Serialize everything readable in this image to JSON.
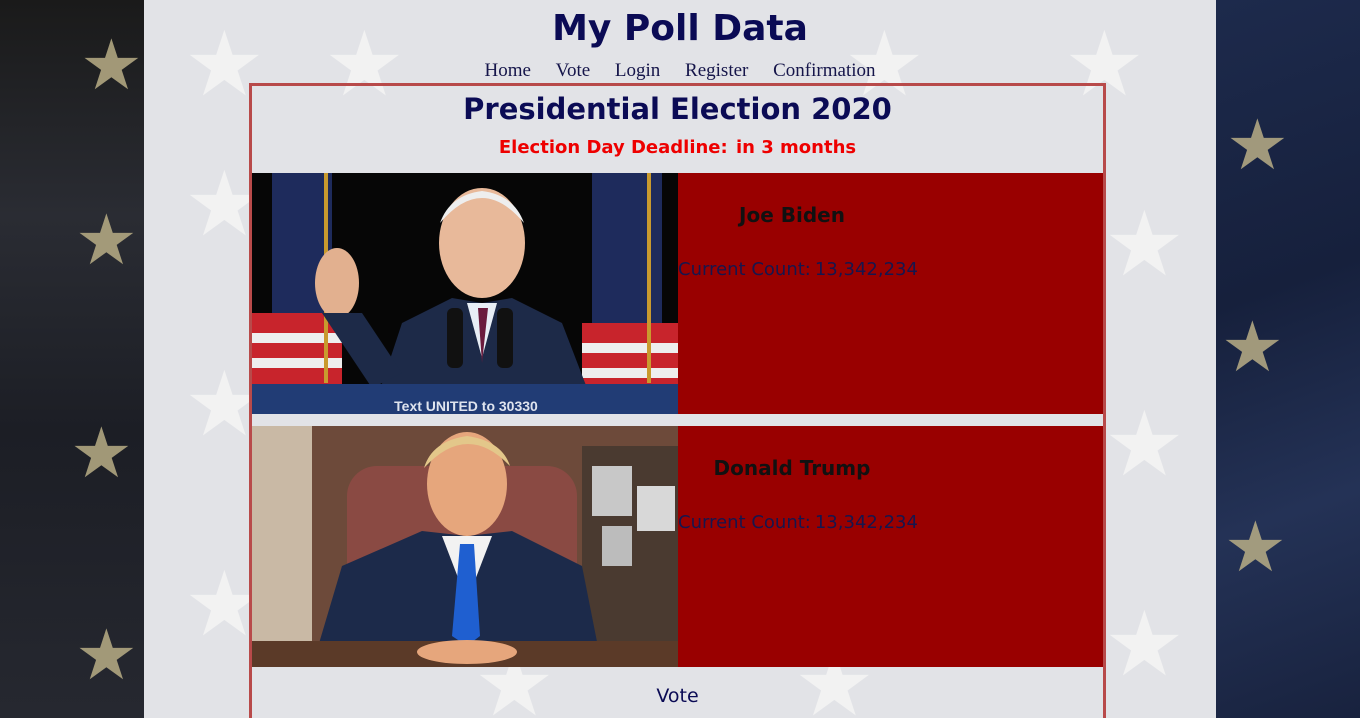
{
  "site": {
    "title": "My Poll Data"
  },
  "nav": [
    {
      "label": "Home"
    },
    {
      "label": "Vote"
    },
    {
      "label": "Login"
    },
    {
      "label": "Register"
    },
    {
      "label": "Confirmation"
    }
  ],
  "poll": {
    "title": "Presidential Election 2020",
    "deadline_label": "Election Day Deadline:",
    "deadline_value": "in 3 months",
    "vote_label": "Vote",
    "candidates": [
      {
        "name": "Joe Biden",
        "count_label": "Current Count:",
        "count": "13,342,234",
        "podium_text": "Text UNITED to 30330"
      },
      {
        "name": "Donald Trump",
        "count_label": "Current Count:",
        "count": "13,342,234"
      }
    ]
  },
  "colors": {
    "title": "#0b0b55",
    "deadline": "#ee0000",
    "candidate_panel": "#990000",
    "box_border": "#b84a4a",
    "page_bg": "#e2e3e7"
  }
}
